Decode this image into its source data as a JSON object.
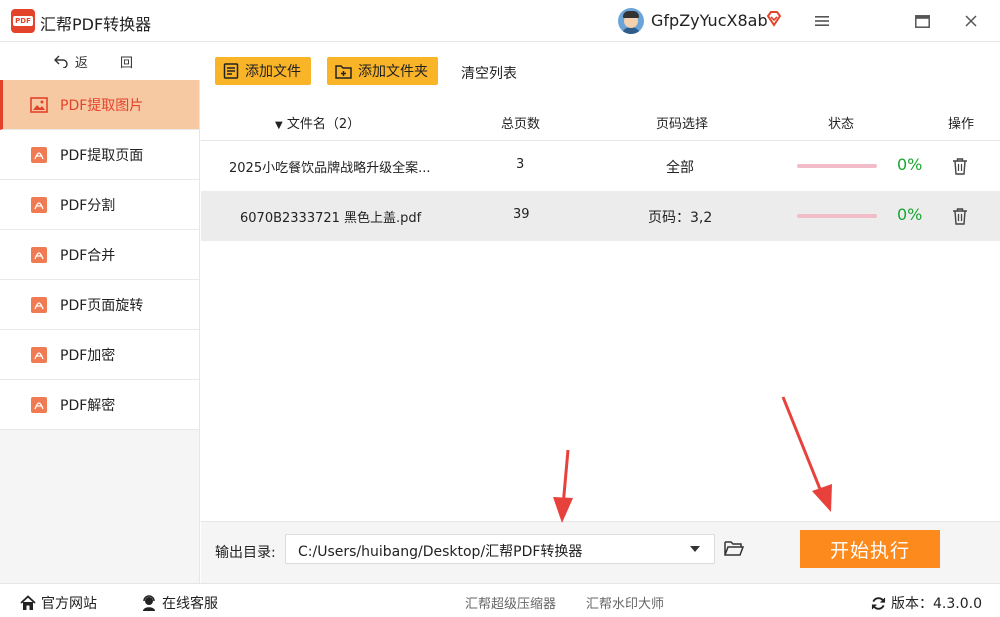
{
  "window": {
    "title": "汇帮PDF转换器",
    "logo_text": "PDF",
    "username": "GfpZyYucX8ab"
  },
  "sidebar": {
    "back_label": "返 回",
    "items": [
      {
        "label": "PDF提取图片",
        "active": true
      },
      {
        "label": "PDF提取页面"
      },
      {
        "label": "PDF分割"
      },
      {
        "label": "PDF合并"
      },
      {
        "label": "PDF页面旋转"
      },
      {
        "label": "PDF加密"
      },
      {
        "label": "PDF解密"
      }
    ]
  },
  "toolbar": {
    "add_file": "添加文件",
    "add_folder": "添加文件夹",
    "clear_list": "清空列表"
  },
  "table": {
    "headers": {
      "filename": "文件名（2）",
      "total_pages": "总页数",
      "page_select": "页码选择",
      "status": "状态",
      "action": "操作"
    },
    "rows": [
      {
        "filename": "2025小吃餐饮品牌战略升级全案...",
        "pages": "3",
        "page_select": "全部",
        "progress": "0%"
      },
      {
        "filename": "6070B2333721 黑色上盖.pdf",
        "pages": "39",
        "page_select": "页码：3,2",
        "progress": "0%"
      }
    ]
  },
  "output": {
    "label": "输出目录:",
    "path": "C:/Users/huibang/Desktop/汇帮PDF转换器",
    "start_button": "开始执行"
  },
  "footer": {
    "website": "官方网站",
    "support": "在线客服",
    "link1": "汇帮超级压缩器",
    "link2": "汇帮水印大师",
    "version": "版本：4.3.0.0"
  },
  "colors": {
    "accent": "#f9b428",
    "active_bg": "#f7c9a3",
    "active_text": "#e3432b",
    "start": "#fd8a1c",
    "progress_text": "#1aa532",
    "arrow": "#e8413c"
  }
}
